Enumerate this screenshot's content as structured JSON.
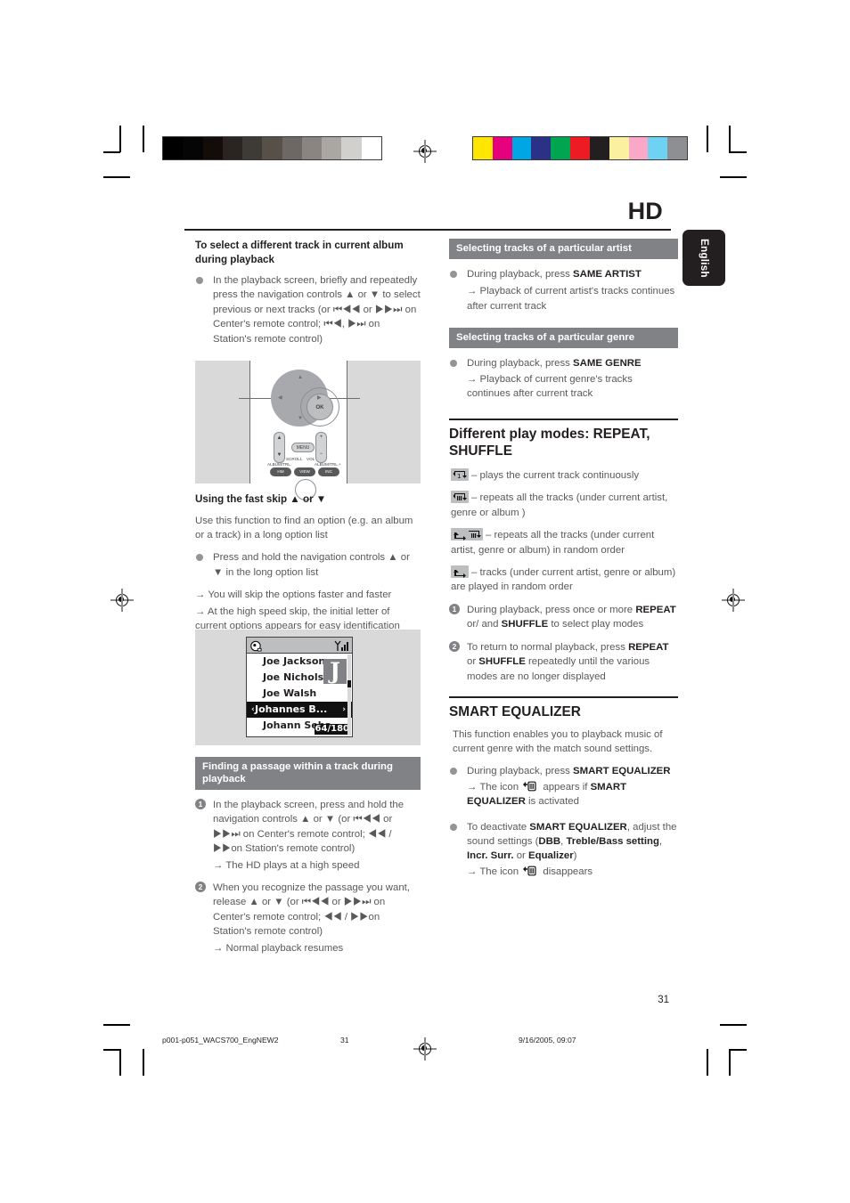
{
  "header": {
    "title": "HD",
    "language_tab": "English"
  },
  "left_column": {
    "heading1": "To select a different track in current album during playback",
    "bullet1": "In the playback screen, briefly and repeatedly press the navigation controls ▲ or ▼ to select previous or next tracks (or ⏮◀◀ or ▶▶⏭ on Center's remote control; ⏮◀, ▶⏭ on Station's remote control)",
    "heading2": "Using the fast skip ▲ or ▼",
    "para2": "Use this function to find an option (e.g. an album or a track) in a long option list",
    "bullet2": "Press and hold the navigation controls ▲ or ▼ in the long option list",
    "arrow2a": "→ You will skip the options faster and faster",
    "arrow2b": "→ At the high speed skip, the initial letter of current options appears for easy identification",
    "band_finding": "Finding a passage within a track during playback",
    "step1": "In the playback screen, press and hold the navigation controls ▲ or ▼ (or ⏮◀◀ or ▶▶⏭ on Center's remote control; ◀◀ / ▶▶on Station's remote control)",
    "step1_arrow": "→ The HD plays at a high speed",
    "step2": "When you recognize the passage you want, release ▲ or ▼ (or ⏮◀◀ or ▶▶⏭ on Center's remote control; ◀◀ / ▶▶on Station's remote control)",
    "step2_arrow": "→ Normal playback resumes",
    "step1_num": "1",
    "step2_num": "2"
  },
  "remote_figure": {
    "ok_label": "OK",
    "menu_label": "MENU",
    "scroll_label": "SCROLL",
    "vol_label": "VOL",
    "scroll_up": "▲",
    "scroll_down": "▼",
    "vol_plus": "+",
    "vol_minus": "−",
    "left_mini_label": "ALBUM/TRL.",
    "right_mini_label": "ALBUM/TRL.+",
    "button1": "HM",
    "button2": "VIEW",
    "button3": "INC"
  },
  "lcd_figure": {
    "rows": [
      "Joe  Jackson",
      "Joe  Nichols",
      "Joe  Walsh"
    ],
    "selected_row": "Johannes B...",
    "last_row": "Johann Seba...",
    "letter_badge": "J",
    "counter": "64/180",
    "arrow_left": "‹",
    "arrow_right": "›"
  },
  "right_column": {
    "band_artist": "Selecting tracks of a particular artist",
    "artist_bullet_pre": "During playback, press ",
    "artist_bullet_key": "SAME ARTIST",
    "artist_arrow": "→ Playback of current artist's tracks continues after current track",
    "band_genre": "Selecting tracks of a particular genre",
    "genre_bullet_pre": "During playback, press ",
    "genre_bullet_key": "SAME GENRE",
    "genre_arrow": "→ Playback of current genre's tracks continues after current track",
    "section_playmodes": "Different play modes: REPEAT, SHUFFLE",
    "mode1": "– plays the current track continuously",
    "mode2": "– repeats all the tracks (under current artist, genre or album )",
    "mode3": "– repeats all the tracks (under current artist, genre or album) in random order",
    "mode4": "– tracks (under current artist, genre or album) are played in random order",
    "step1_num": "1",
    "step1_a": "During playback, press once or more ",
    "step1_key1": "REPEAT",
    "step1_b": " or/ and ",
    "step1_key2": "SHUFFLE",
    "step1_c": " to select play modes",
    "step2_num": "2",
    "step2_a": "To return to normal playback, press ",
    "step2_key1": "REPEAT",
    "step2_b": " or ",
    "step2_key2": "SHUFFLE",
    "step2_c": " repeatedly until the various modes are no longer displayed",
    "section_equalizer": "SMART EQUALIZER",
    "eq_intro": "This function enables you to playback music of current genre with the match sound settings.",
    "eq_b1_pre": "During playback, press ",
    "eq_b1_key": "SMART EQUALIZER",
    "eq_b1_arrow_a": "→ The icon ",
    "eq_b1_arrow_b": " appears if ",
    "eq_b1_key2": "SMART EQUALIZER",
    "eq_b1_arrow_c": " is activated",
    "eq_b2_pre": "To deactivate ",
    "eq_b2_key": "SMART EQUALIZER",
    "eq_b2_mid": ", adjust the sound settings (",
    "eq_b2_k1": "DBB",
    "eq_b2_s1": ", ",
    "eq_b2_k2": "Treble/Bass setting",
    "eq_b2_s2": ", ",
    "eq_b2_k3": "Incr. Surr.",
    "eq_b2_s3": " or ",
    "eq_b2_k4": "Equalizer",
    "eq_b2_s4": ")",
    "eq_b2_arrow_a": "→ The icon ",
    "eq_b2_arrow_b": " disappears"
  },
  "footer": {
    "page_number": "31",
    "file_name": "p001-p051_WACS700_EngNEW2",
    "footer_page": "31",
    "timestamp": "9/16/2005, 09:07"
  },
  "colors": {
    "band_gray": "#808285",
    "text_gray": "#58595b",
    "ink": "#231f20",
    "figure_bg": "#d9d9d9"
  }
}
